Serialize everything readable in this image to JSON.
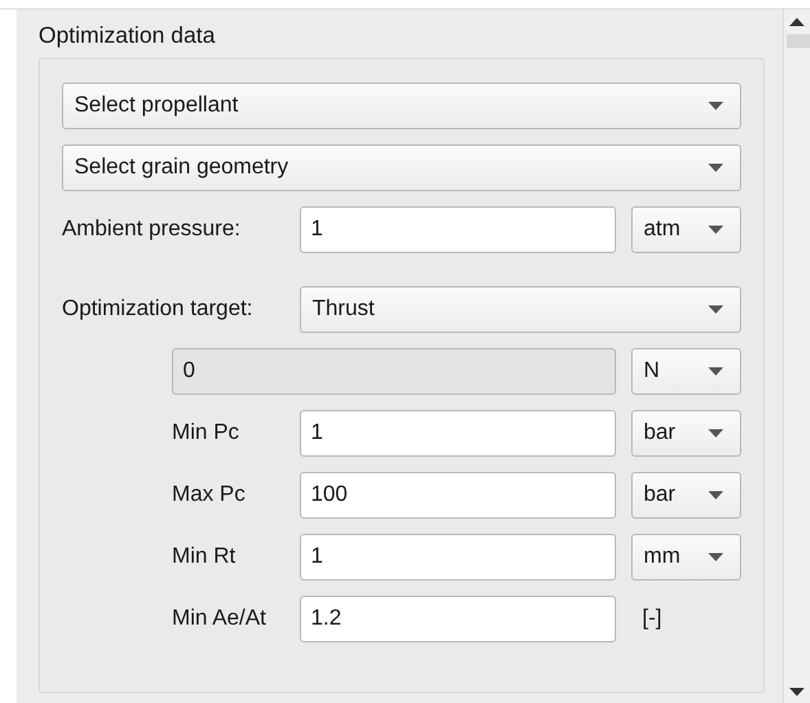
{
  "panel": {
    "title": "Optimization data"
  },
  "selects": [
    {
      "value": "Select propellant"
    },
    {
      "value": "Select grain geometry"
    }
  ],
  "ambient_pressure": {
    "label": "Ambient pressure:",
    "value": "1",
    "unit": "atm"
  },
  "optimization_target": {
    "label": "Optimization target:",
    "value": "Thrust"
  },
  "target_value": {
    "value": "0",
    "unit": "N",
    "disabled": true
  },
  "constraints": [
    {
      "label": "Min Pc",
      "value": "1",
      "unit": "bar",
      "kind": "dropdown"
    },
    {
      "label": "Max Pc",
      "value": "100",
      "unit": "bar",
      "kind": "dropdown"
    },
    {
      "label": "Min Rt",
      "value": "1",
      "unit": "mm",
      "kind": "dropdown"
    },
    {
      "label": "Min Ae/At",
      "value": "1.2",
      "unit": "[-]",
      "kind": "static"
    }
  ]
}
